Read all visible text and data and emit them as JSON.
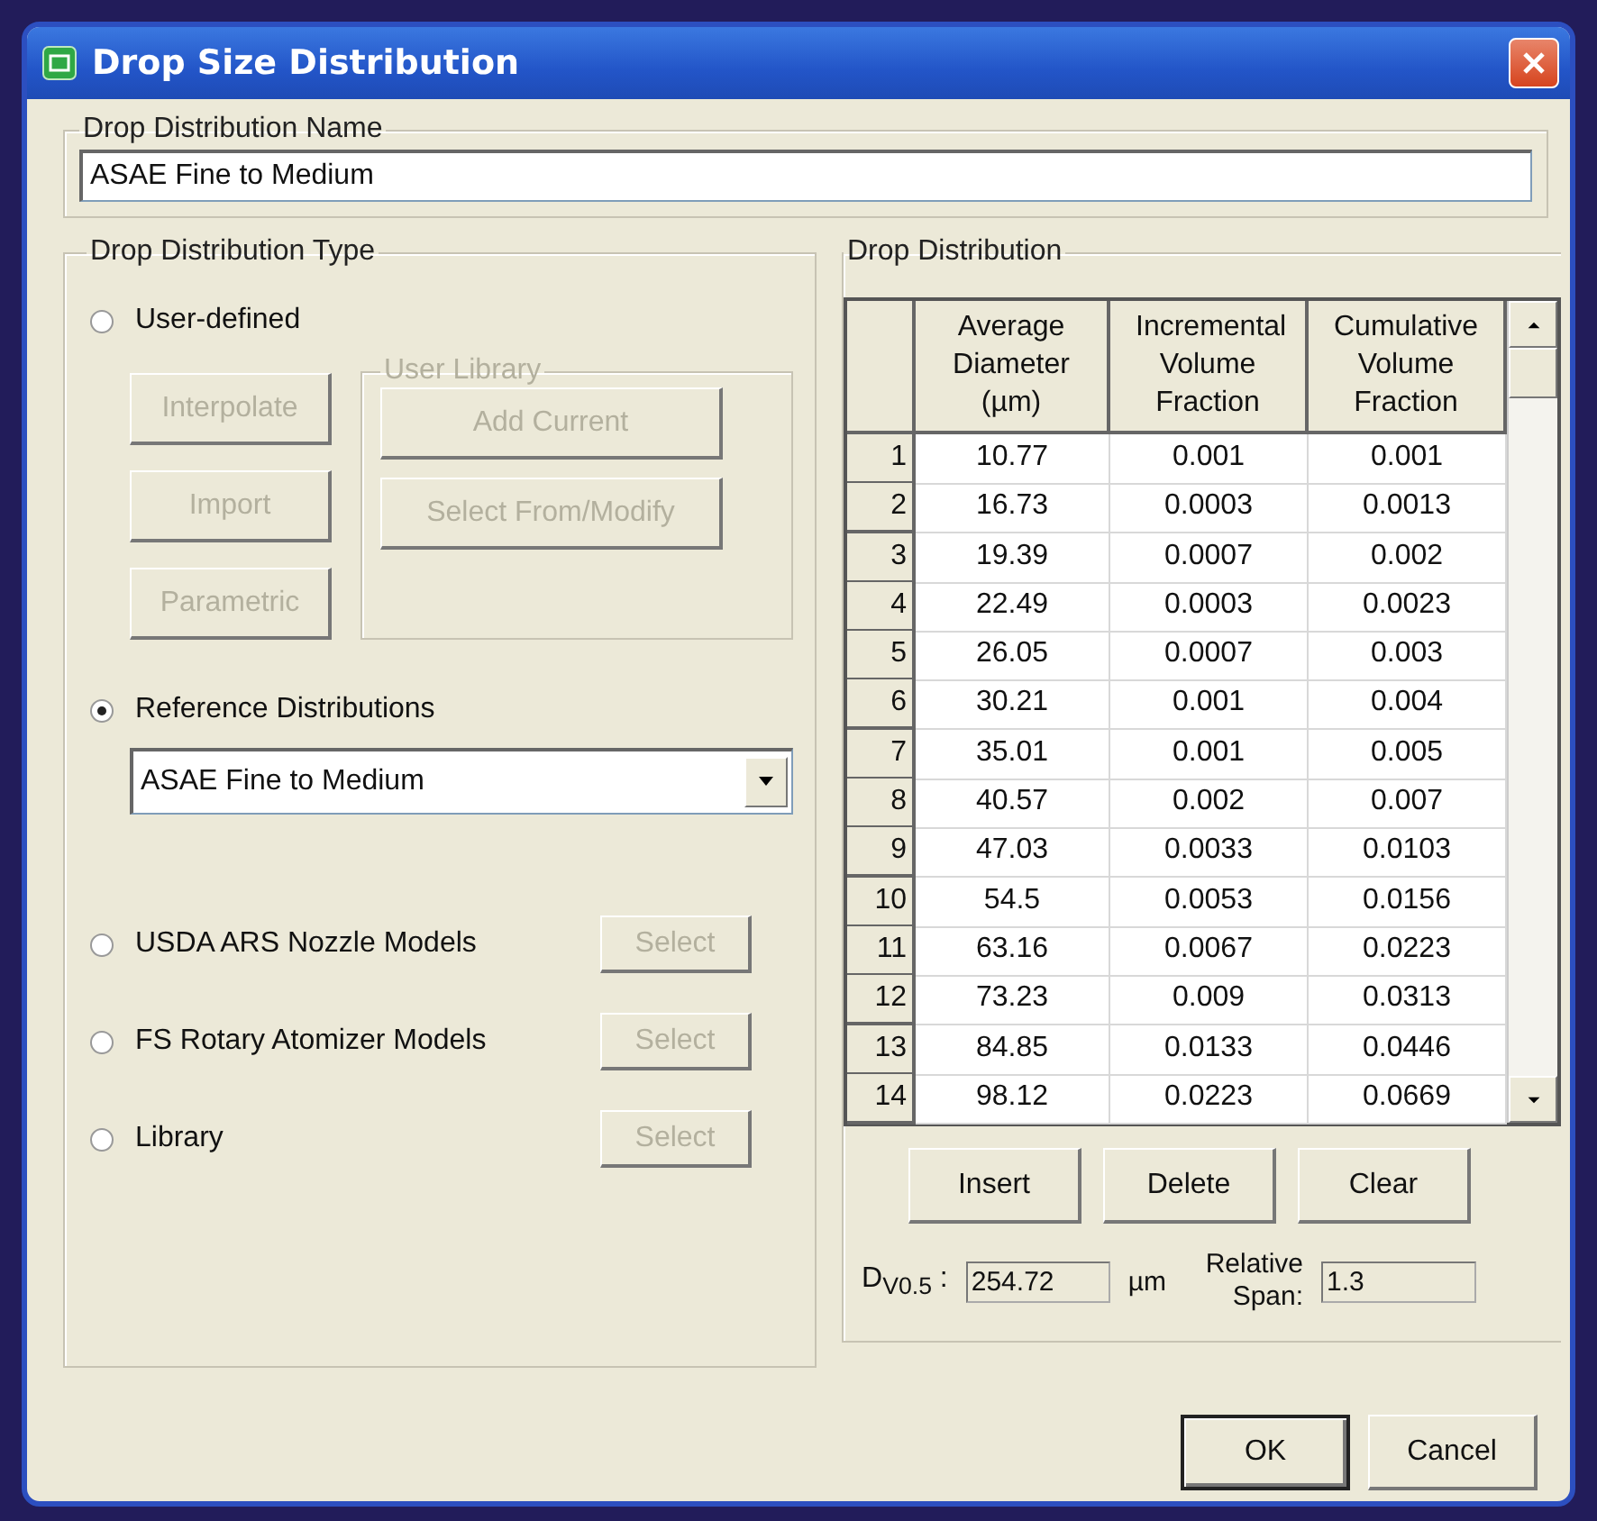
{
  "window": {
    "title": "Drop Size Distribution"
  },
  "name_group": {
    "label": "Drop Distribution Name",
    "value": "ASAE Fine to Medium"
  },
  "type_group": {
    "label": "Drop Distribution Type",
    "user_defined": {
      "label": "User-defined",
      "selected": false
    },
    "user_buttons": [
      {
        "label": "Interpolate",
        "disabled": true
      },
      {
        "label": "Import",
        "disabled": true
      },
      {
        "label": "Parametric",
        "disabled": true
      }
    ],
    "user_library": {
      "label": "User Library",
      "disabled": true,
      "buttons": [
        {
          "label": "Add Current",
          "disabled": true
        },
        {
          "label": "Select From/Modify",
          "disabled": true
        }
      ]
    },
    "reference": {
      "label": "Reference Distributions",
      "selected": true,
      "dropdown_value": "ASAE Fine to Medium"
    },
    "models": [
      {
        "label": "USDA ARS Nozzle Models",
        "selected": false,
        "button": {
          "label": "Select",
          "disabled": true
        }
      },
      {
        "label": "FS Rotary Atomizer Models",
        "selected": false,
        "button": {
          "label": "Select",
          "disabled": true
        }
      },
      {
        "label": "Library",
        "selected": false,
        "button": {
          "label": "Select",
          "disabled": true
        }
      }
    ]
  },
  "distribution": {
    "label": "Drop Distribution",
    "table": {
      "columns": [
        "",
        "Average Diameter (µm)",
        "Incremental Volume Fraction",
        "Cumulative Volume Fraction"
      ],
      "rows": [
        [
          "1",
          "10.77",
          "0.001",
          "0.001"
        ],
        [
          "2",
          "16.73",
          "0.0003",
          "0.0013"
        ],
        [
          "3",
          "19.39",
          "0.0007",
          "0.002"
        ],
        [
          "4",
          "22.49",
          "0.0003",
          "0.0023"
        ],
        [
          "5",
          "26.05",
          "0.0007",
          "0.003"
        ],
        [
          "6",
          "30.21",
          "0.001",
          "0.004"
        ],
        [
          "7",
          "35.01",
          "0.001",
          "0.005"
        ],
        [
          "8",
          "40.57",
          "0.002",
          "0.007"
        ],
        [
          "9",
          "47.03",
          "0.0033",
          "0.0103"
        ],
        [
          "10",
          "54.5",
          "0.0053",
          "0.0156"
        ],
        [
          "11",
          "63.16",
          "0.0067",
          "0.0223"
        ],
        [
          "12",
          "73.23",
          "0.009",
          "0.0313"
        ],
        [
          "13",
          "84.85",
          "0.0133",
          "0.0446"
        ],
        [
          "14",
          "98.12",
          "0.0223",
          "0.0669"
        ]
      ]
    },
    "buttons": [
      {
        "label": "Insert",
        "disabled": false
      },
      {
        "label": "Delete",
        "disabled": false
      },
      {
        "label": "Clear",
        "disabled": false
      }
    ],
    "dv_label": "D$_{V0.5}$ :",
    "dv_value": "254.72",
    "dv_unit": "µm",
    "span_label": "Relative Span:",
    "span_value": "1.3"
  },
  "buttons": [
    {
      "label": "OK",
      "default": true
    },
    {
      "label": "Cancel",
      "default": false
    }
  ]
}
